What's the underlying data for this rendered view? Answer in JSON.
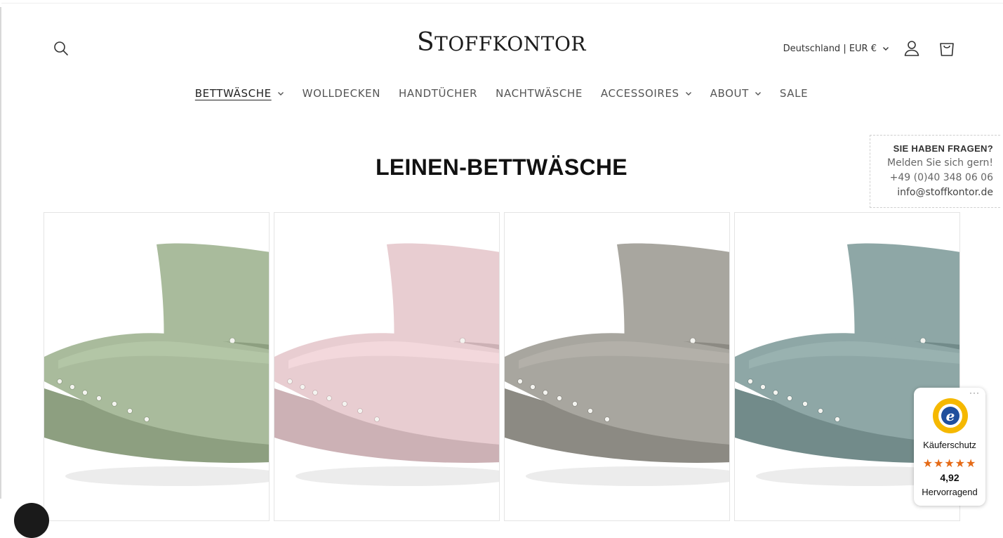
{
  "header": {
    "logo_initial": "S",
    "logo_rest": "TOFFKONTOR",
    "locale": "Deutschland | EUR €",
    "icons": {
      "search": "search-icon",
      "account": "user-icon",
      "cart": "shopping-bag-icon"
    }
  },
  "nav": {
    "items": [
      {
        "label": "BETTWÄSCHE"
      },
      {
        "label": "WOLLDECKEN"
      },
      {
        "label": "HANDTÜCHER"
      },
      {
        "label": "NACHTWÄSCHE"
      },
      {
        "label": "ACCESSOIRES"
      },
      {
        "label": "ABOUT"
      },
      {
        "label": "SALE"
      }
    ]
  },
  "page": {
    "title": "LEINEN-BETTWÄSCHE"
  },
  "contact": {
    "question": "SIE HABEN FRAGEN?",
    "invite": "Melden Sie sich gern!",
    "phone": "+49 (0)40 348 06 06",
    "email": "info@stoffkontor.de"
  },
  "products": [
    {
      "color": "#a9bb9c"
    },
    {
      "color": "#e8cdd1"
    },
    {
      "color": "#a8a69f"
    },
    {
      "color": "#8ea7a6"
    }
  ],
  "trusted_shops": {
    "more": "···",
    "label": "Käuferschutz",
    "stars": "★★★★★",
    "rating": "4,92",
    "rating_text": "Hervorragend",
    "accent": "#e56a16"
  }
}
